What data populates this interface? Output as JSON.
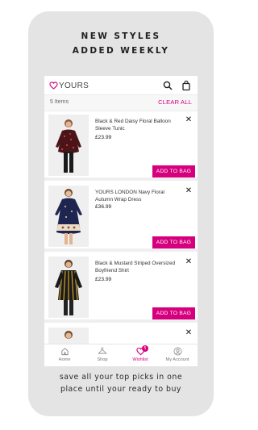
{
  "headline": {
    "line1": "NEW STYLES",
    "line2": "ADDED WEEKLY"
  },
  "app": {
    "logo_text": "YOURS",
    "icons": {
      "search": "search-icon",
      "bag": "shopping-bag-icon",
      "logo": "heart-logo-icon"
    }
  },
  "wishlist": {
    "count_label": "5 Items",
    "clear_label": "CLEAR ALL",
    "items": [
      {
        "title": "Black & Red Daisy Floral Balloon Sleeve Tunic",
        "price": "£23.99",
        "button": "ADD TO BAG",
        "close": "✕"
      },
      {
        "title": "YOURS LONDON Navy Floral Autumn Wrap Dress",
        "price": "£36.99",
        "button": "ADD TO BAG",
        "close": "✕"
      },
      {
        "title": "Black & Mustard Striped Oversized Boyfriend Shirt",
        "price": "£23.99",
        "button": "ADD TO BAG",
        "close": "✕"
      },
      {
        "close": "✕"
      }
    ]
  },
  "nav": {
    "items": [
      {
        "label": "Home",
        "icon": "home-icon"
      },
      {
        "label": "Shop",
        "icon": "hanger-icon"
      },
      {
        "label": "Wishlist",
        "icon": "heart-icon",
        "badge": "5",
        "active": true
      },
      {
        "label": "My Account",
        "icon": "account-icon"
      }
    ]
  },
  "caption": {
    "line1": "save all your top picks in one",
    "line2": "place until your ready to buy"
  },
  "colors": {
    "accent": "#d6007e",
    "card_bg": "#e4e4e4"
  }
}
